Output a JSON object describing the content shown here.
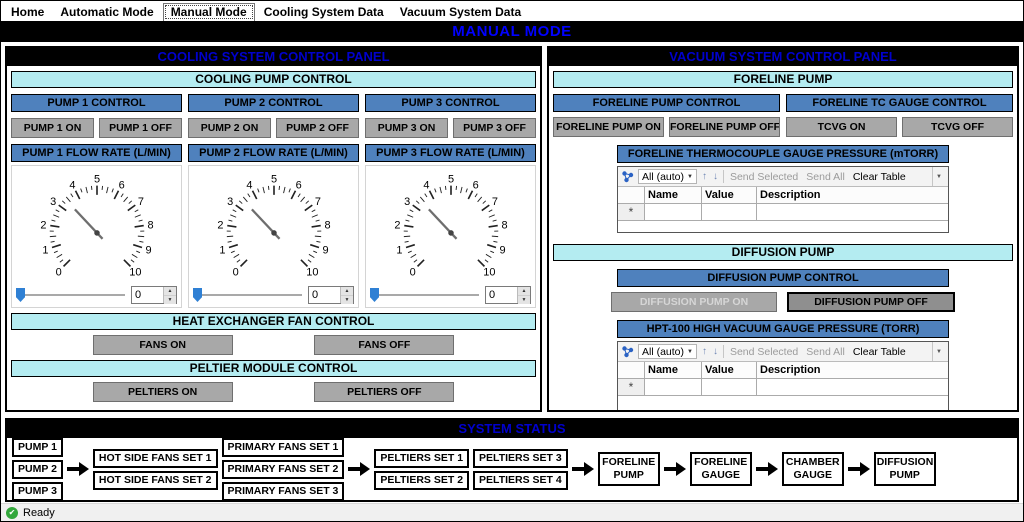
{
  "colors": {
    "banner_text": "#0101ff",
    "panel_title_text": "#0000cd",
    "cyan_bar_bg": "#b4ecf1",
    "steel_header_bg": "#4f81bd",
    "button_bg": "#a8a8a8",
    "slider_thumb": "#2f80d4",
    "status_ok_green": "#33a73c"
  },
  "window": {
    "tabs": [
      "Home",
      "Automatic Mode",
      "Manual Mode",
      "Cooling System Data",
      "Vacuum System Data"
    ],
    "active_tab": "Manual Mode",
    "banner": "MANUAL MODE",
    "status_text": "Ready"
  },
  "cooling": {
    "title": "COOLING SYSTEM CONTROL PANEL",
    "pump_section_header": "COOLING PUMP CONTROL",
    "pumps": [
      {
        "control_header": "PUMP 1 CONTROL",
        "on_label": "PUMP 1 ON",
        "off_label": "PUMP 1 OFF",
        "flow_header": "PUMP 1 FLOW RATE (L/MIN)",
        "flow_value": "0"
      },
      {
        "control_header": "PUMP 2 CONTROL",
        "on_label": "PUMP 2 ON",
        "off_label": "PUMP 2 OFF",
        "flow_header": "PUMP 2 FLOW RATE (L/MIN)",
        "flow_value": "0"
      },
      {
        "control_header": "PUMP 3 CONTROL",
        "on_label": "PUMP 3 ON",
        "off_label": "PUMP 3 OFF",
        "flow_header": "PUMP 3 FLOW RATE (L/MIN)",
        "flow_value": "0"
      }
    ],
    "gauge": {
      "min": 0,
      "max": 10,
      "ticks": [
        "0",
        "1",
        "2",
        "3",
        "4",
        "5",
        "6",
        "7",
        "8",
        "9",
        "10"
      ],
      "needle_value": 3.4
    },
    "fan_section_header": "HEAT EXCHANGER FAN CONTROL",
    "fans_on_label": "FANS ON",
    "fans_off_label": "FANS OFF",
    "peltier_section_header": "PELTIER MODULE CONTROL",
    "peltiers_on_label": "PELTIERS ON",
    "peltiers_off_label": "PELTIERS OFF"
  },
  "vacuum": {
    "title": "VACUUM SYSTEM CONTROL PANEL",
    "foreline_section_header": "FORELINE PUMP",
    "foreline_pump_control_header": "FORELINE PUMP CONTROL",
    "foreline_tc_control_header": "FORELINE TC GAUGE CONTROL",
    "foreline_pump_on_label": "FORELINE PUMP ON",
    "foreline_pump_off_label": "FORELINE PUMP OFF",
    "tcvg_on_label": "TCVG ON",
    "tcvg_off_label": "TCVG OFF",
    "foreline_pressure_header": "FORELINE THERMOCOUPLE GAUGE PRESSURE (mTORR)",
    "diffusion_section_header": "DIFFUSION PUMP",
    "diffusion_control_header": "DIFFUSION PUMP CONTROL",
    "diffusion_on_label": "DIFFUSION PUMP ON",
    "diffusion_off_label": "DIFFUSION PUMP OFF",
    "hv_pressure_header": "HPT-100 HIGH VACUUM GAUGE PRESSURE (TORR)",
    "grid": {
      "channel_dropdown": "All (auto)",
      "send_selected_label": "Send Selected",
      "send_all_label": "Send All",
      "clear_table_label": "Clear Table",
      "columns": [
        "Name",
        "Value",
        "Description"
      ],
      "new_row_marker": "*"
    }
  },
  "system_status": {
    "title": "SYSTEM STATUS",
    "pumps": [
      "PUMP 1",
      "PUMP 2",
      "PUMP 3"
    ],
    "hot_side_fans": [
      "HOT SIDE FANS SET 1",
      "HOT SIDE FANS SET 2"
    ],
    "primary_fans": [
      "PRIMARY FANS SET 1",
      "PRIMARY FANS SET 2",
      "PRIMARY FANS SET 3"
    ],
    "peltiers_left": [
      "PELTIERS SET 1",
      "PELTIERS SET 2"
    ],
    "peltiers_right": [
      "PELTIERS SET 3",
      "PELTIERS SET 4"
    ],
    "foreline_pump": "FORELINE PUMP",
    "foreline_gauge": "FORELINE GAUGE",
    "chamber_gauge": "CHAMBER GAUGE",
    "diffusion_pump": "DIFFUSION PUMP"
  }
}
